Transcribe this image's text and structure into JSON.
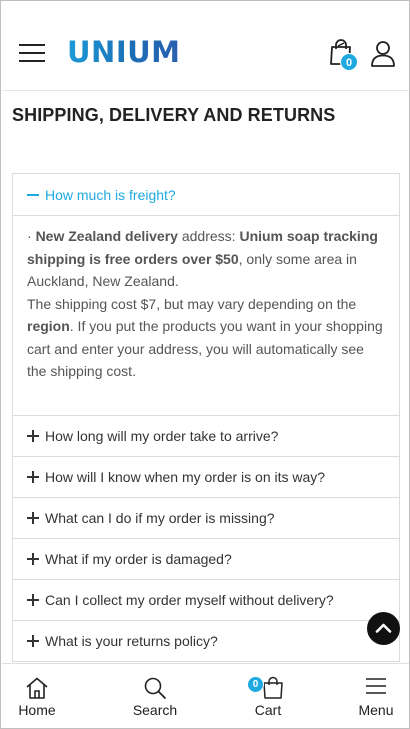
{
  "header": {
    "logo_text": "UNIUM",
    "cart_count": "0",
    "icons": [
      "hamburger-icon",
      "shopping-bag-icon",
      "user-icon"
    ]
  },
  "page": {
    "title": "SHIPPING, DELIVERY AND RETURNS"
  },
  "faq": {
    "open_item": {
      "question": "How much is freight?",
      "answer": {
        "bullet": "· ",
        "p1_b1": "New Zealand delivery",
        "p1_t1": " address: ",
        "p1_b2": "Unium soap tracking shipping is free orders over $50",
        "p1_t2": ", only some area in Auckland, New Zealand.",
        "p2_t1": "The shipping cost $7, but may vary depending on the ",
        "p2_b1": "region",
        "p2_t2": ". If you put the products you want in your shopping cart and enter your address, you will automatically see the shipping cost."
      }
    },
    "items": [
      {
        "question": "How long will my order take to arrive?"
      },
      {
        "question": "How will I know when my order is on its way?"
      },
      {
        "question": "What can I do if my order is missing?"
      },
      {
        "question": "What if my order is damaged?"
      },
      {
        "question": "Can I collect my order myself without delivery?"
      },
      {
        "question": "What is your returns policy?"
      }
    ]
  },
  "bottom_nav": {
    "home": "Home",
    "search": "Search",
    "cart": "Cart",
    "cart_count": "0",
    "menu": "Menu"
  },
  "colors": {
    "accent": "#1fa9e1",
    "logo": "#1b75bb",
    "text": "#333333"
  }
}
